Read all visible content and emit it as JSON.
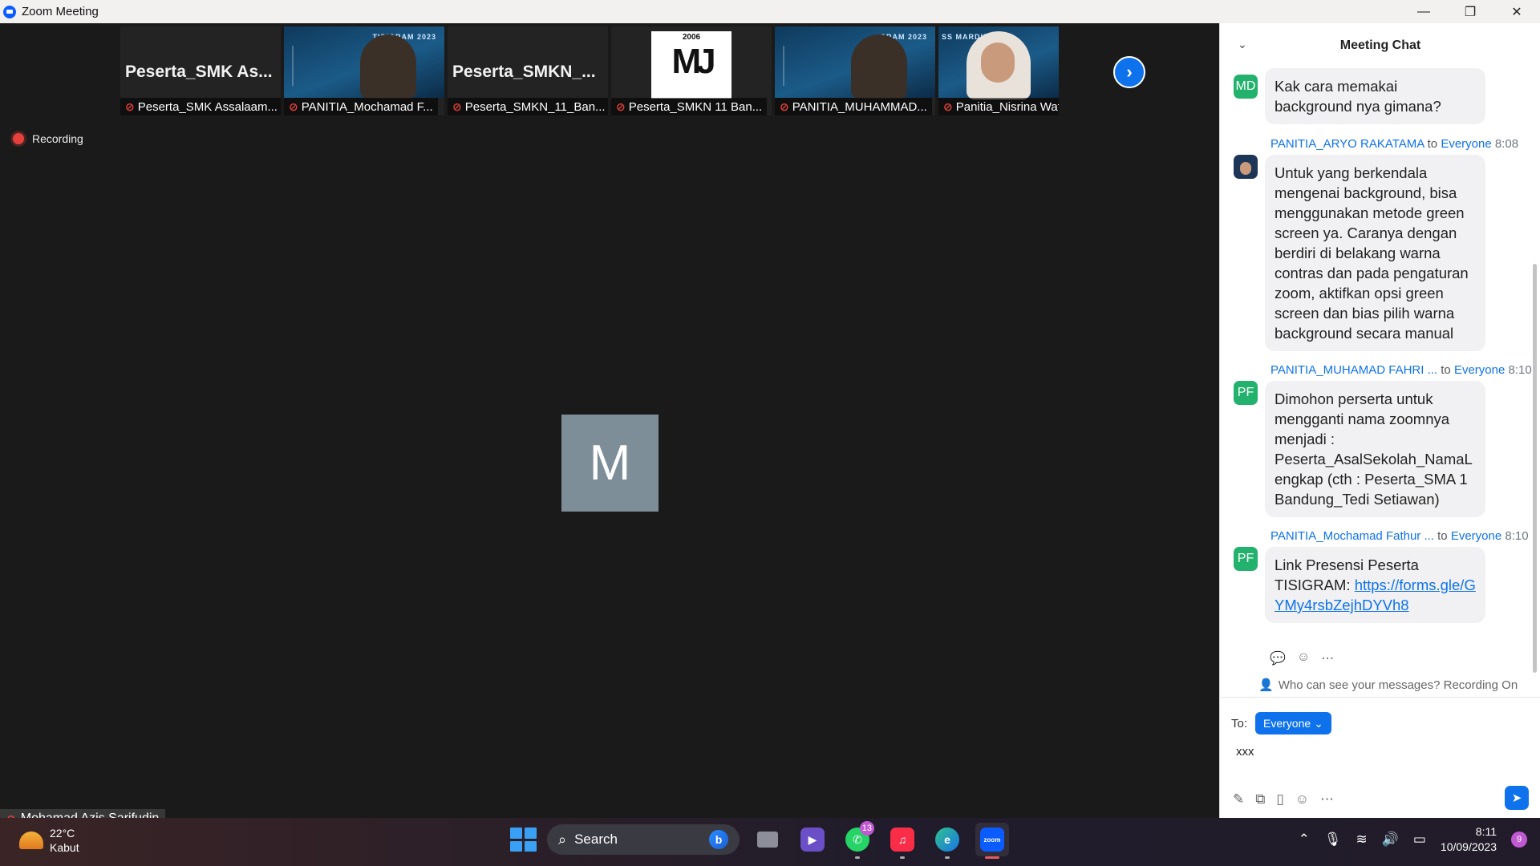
{
  "window": {
    "title": "Zoom Meeting",
    "controls": {
      "minimize": "—",
      "maximize": "❐",
      "close": "✕"
    }
  },
  "meeting": {
    "recording_label": "Recording",
    "main_avatar_initial": "M",
    "self_name": "Mohamad Azis Sarifudin",
    "next_page_icon": "chevron-right-icon",
    "participants": [
      {
        "name": "Peserta_SMK Assalaam...",
        "display": "Peserta_SMK  As...",
        "kind": "name"
      },
      {
        "name": "PANITIA_Mochamad F...",
        "banner": "TISIGRAM 2023",
        "kind": "video"
      },
      {
        "name": "Peserta_SMKN_11_Ban...",
        "display": "Peserta_SMKN_...",
        "kind": "name"
      },
      {
        "name": "Peserta_SMKN 11 Ban...",
        "logo_year": "2006",
        "logo_mark": "MJ",
        "kind": "logo"
      },
      {
        "name": "PANITIA_MUHAMMAD...",
        "banner": "GRAM 2023",
        "kind": "video"
      },
      {
        "name": "Panitia_Nisrina Wafa Z...",
        "banner": "SS MARDIBIT",
        "kind": "video"
      }
    ]
  },
  "chat": {
    "title": "Meeting Chat",
    "messages": [
      {
        "avatar": "MD",
        "avatar_color": "#23b26d",
        "sender": "",
        "to": "",
        "time": "",
        "text": "Kak cara memakai background nya gimana?"
      },
      {
        "avatar": "",
        "avatar_color": "#1d3556",
        "sender": "PANITIA_ARYO RAKATAMA",
        "to": "to",
        "target": "Everyone",
        "time": "8:08",
        "text": "Untuk yang berkendala mengenai background, bisa menggunakan metode green screen ya. Caranya dengan berdiri di belakang warna contras dan pada pengaturan zoom, aktifkan opsi green screen dan bias pilih warna background secara manual"
      },
      {
        "avatar": "PF",
        "avatar_color": "#23b26d",
        "sender": "PANITIA_MUHAMAD FAHRI ...",
        "to": "to",
        "target": "Everyone",
        "time": "8:10",
        "text": "Dimohon perserta untuk mengganti nama zoomnya menjadi : Peserta_AsalSekolah_NamaLengkap (cth : Peserta_SMA 1 Bandung_Tedi Setiawan)"
      },
      {
        "avatar": "PF",
        "avatar_color": "#23b26d",
        "sender": "PANITIA_Mochamad Fathur ...",
        "to": "to",
        "target": "Everyone",
        "time": "8:10",
        "text": " Link Presensi Peserta TISIGRAM:",
        "link": "https://forms.gle/GYMy4rsbZejhDYVh8"
      }
    ],
    "visibility_note": "Who can see your messages? Recording On",
    "to_label": "To:",
    "recipient": "Everyone",
    "draft": "xxx"
  },
  "taskbar": {
    "weather": {
      "temp": "22°C",
      "condition": "Kabut"
    },
    "search_placeholder": "Search",
    "whatsapp_badge": "13",
    "time": "8:11",
    "date": "10/09/2023",
    "notification_count": "9"
  }
}
